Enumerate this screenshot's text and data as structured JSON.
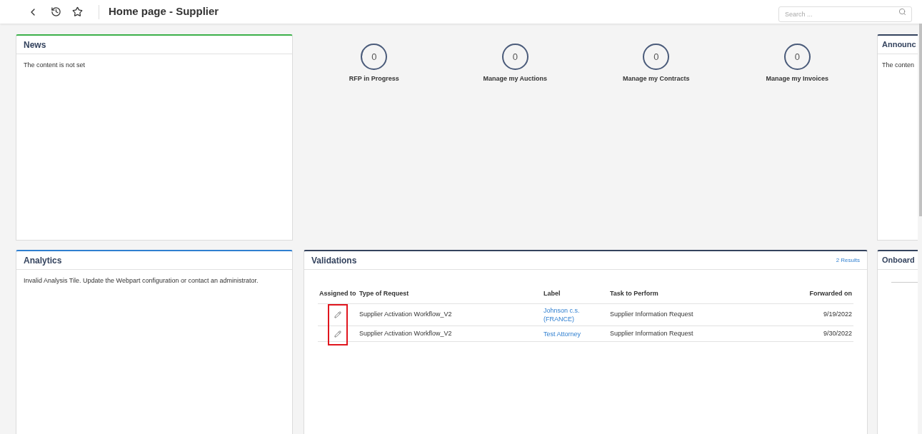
{
  "header": {
    "title": "Home page - Supplier",
    "search": {
      "placeholder": "Search ..."
    }
  },
  "news": {
    "title": "News",
    "color": "#3cb04a",
    "text": "The content is not set"
  },
  "counters": [
    {
      "value": "0",
      "label": "RFP in Progress"
    },
    {
      "value": "0",
      "label": "Manage my Auctions"
    },
    {
      "value": "0",
      "label": "Manage my Contracts"
    },
    {
      "value": "0",
      "label": "Manage my Invoices"
    }
  ],
  "announcements": {
    "title": "Announc",
    "color": "#34435e",
    "text": "The conten"
  },
  "analytics": {
    "title": "Analytics",
    "color": "#2f7fd0",
    "text": "Invalid Analysis Tile. Update the Webpart configuration or contact an administrator."
  },
  "validations": {
    "title": "Validations",
    "color": "#34435e",
    "results": "2 Results",
    "highlighted": true,
    "columns": [
      "Assigned to",
      "Type of Request",
      "Label",
      "Task to Perform",
      "Forwarded on"
    ],
    "rows": [
      {
        "type": "Supplier Activation Workflow_V2",
        "label": "Johnson c.s. (FRANCE)",
        "task": "Supplier Information Request",
        "date": "9/19/2022"
      },
      {
        "type": "Supplier Activation Workflow_V2",
        "label": "Test Attorney",
        "task": "Supplier Information Request",
        "date": "9/30/2022"
      }
    ]
  },
  "onboarding": {
    "title": "Onboard",
    "color": "#34435e"
  }
}
